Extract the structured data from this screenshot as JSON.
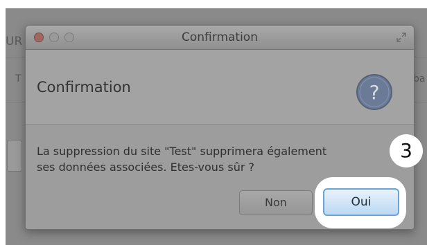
{
  "background": {
    "left_label": "UR",
    "left_label2": "T",
    "right_label": "ba"
  },
  "dialog": {
    "window_title": "Confirmation",
    "header_title": "Confirmation",
    "message_line1": "La suppression du site \"Test\" supprimera également",
    "message_line2": "ses données associées. Etes-vous sûr ?",
    "buttons": {
      "no_label": "Non",
      "yes_label": "Oui"
    },
    "icons": {
      "close": "close-icon",
      "minimize": "minimize-icon",
      "maximize": "maximize-icon",
      "fullscreen": "fullscreen-icon",
      "question": "question-icon"
    }
  },
  "annotation": {
    "step_number": "3"
  },
  "colors": {
    "dim_overlay": "#8a8a8a",
    "dialog_bg": "#9d9d9d",
    "default_button_border": "#6aa3d8",
    "question_icon": "#6b7a96"
  }
}
